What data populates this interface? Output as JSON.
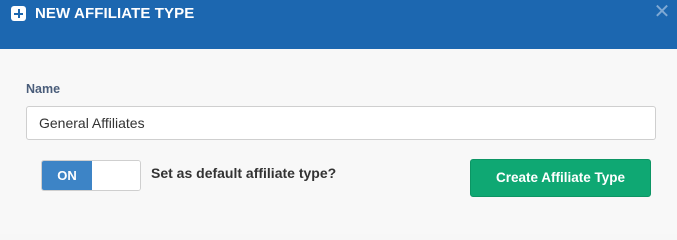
{
  "dialog": {
    "title": "NEW AFFILIATE TYPE",
    "header_icon": "plus-square-icon",
    "close_icon": "close-icon",
    "header_color": "#1c67b0"
  },
  "form": {
    "name_label": "Name",
    "name_value": "General Affiliates",
    "default_toggle": {
      "on_label": "ON",
      "state": "on",
      "on_color": "#3d84c6"
    },
    "default_label": "Set as default affiliate type?",
    "submit_label": "Create Affiliate Type",
    "submit_color": "#0fa873"
  }
}
